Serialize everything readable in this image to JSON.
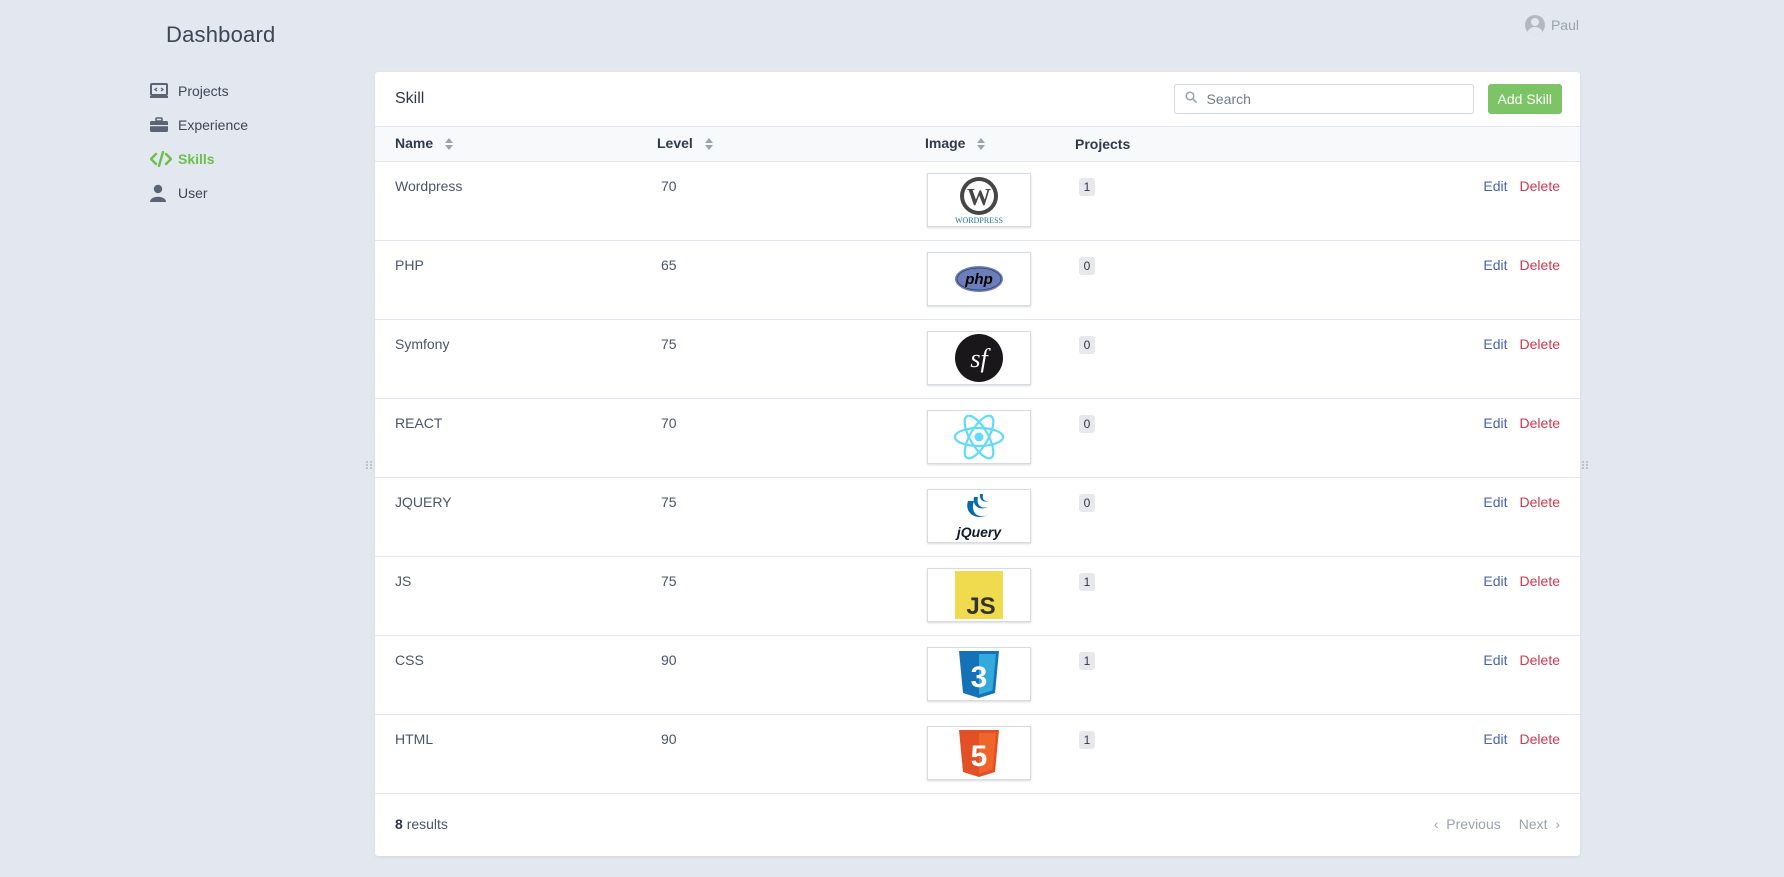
{
  "app": {
    "title": "Dashboard",
    "user_name": "Paul"
  },
  "sidebar": {
    "items": [
      {
        "label": "Projects",
        "icon": "laptop-icon",
        "active": false
      },
      {
        "label": "Experience",
        "icon": "briefcase-icon",
        "active": false
      },
      {
        "label": "Skills",
        "icon": "code-icon",
        "active": true
      },
      {
        "label": "User",
        "icon": "user-icon",
        "active": false
      }
    ]
  },
  "main": {
    "title": "Skill",
    "search_placeholder": "Search",
    "add_label": "Add Skill",
    "columns": [
      "Name",
      "Level",
      "Image",
      "Projects"
    ],
    "edit_label": "Edit",
    "delete_label": "Delete",
    "rows": [
      {
        "name": "Wordpress",
        "level": "70",
        "image": "wordpress-logo",
        "projects": "1"
      },
      {
        "name": "PHP",
        "level": "65",
        "image": "php-logo",
        "projects": "0"
      },
      {
        "name": "Symfony",
        "level": "75",
        "image": "symfony-logo",
        "projects": "0"
      },
      {
        "name": "REACT",
        "level": "70",
        "image": "react-logo",
        "projects": "0"
      },
      {
        "name": "JQUERY",
        "level": "75",
        "image": "jquery-logo",
        "projects": "0"
      },
      {
        "name": "JS",
        "level": "75",
        "image": "js-logo",
        "projects": "1"
      },
      {
        "name": "CSS",
        "level": "90",
        "image": "css3-logo",
        "projects": "1"
      },
      {
        "name": "HTML",
        "level": "90",
        "image": "html5-logo",
        "projects": "1"
      }
    ],
    "footer": {
      "count": "8",
      "results_label": "results",
      "previous_label": "Previous",
      "next_label": "Next"
    }
  },
  "colors": {
    "accent": "#7cc465",
    "edit": "#4a63b8",
    "delete": "#d0384f",
    "background": "#e3e7ef"
  }
}
